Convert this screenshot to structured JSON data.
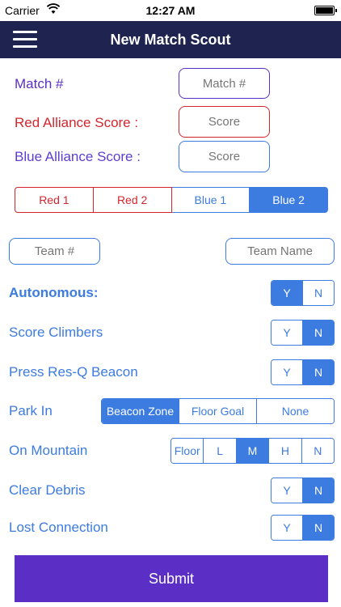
{
  "status_bar": {
    "carrier": "Carrier",
    "wifi_icon": "wifi-icon",
    "time": "12:27 AM",
    "battery_icon": "battery-icon"
  },
  "nav": {
    "menu_icon": "hamburger-menu-icon",
    "title": "New Match Scout"
  },
  "match": {
    "label": "Match #",
    "placeholder": "Match #"
  },
  "red_score": {
    "label": "Red Alliance Score :",
    "placeholder": "Score"
  },
  "blue_score": {
    "label": "Blue Alliance Score :",
    "placeholder": "Score"
  },
  "alliance_options": [
    "Red 1",
    "Red 2",
    "Blue 1",
    "Blue 2"
  ],
  "alliance_selected": "Blue 2",
  "team": {
    "number_placeholder": "Team #",
    "name_placeholder": "Team Name"
  },
  "autonomous": {
    "label": "Autonomous:",
    "options": [
      "Y",
      "N"
    ],
    "selected": "Y"
  },
  "score_climbers": {
    "label": "Score Climbers",
    "options": [
      "Y",
      "N"
    ],
    "selected": "N"
  },
  "press_beacon": {
    "label": "Press Res-Q Beacon",
    "options": [
      "Y",
      "N"
    ],
    "selected": "N"
  },
  "park_in": {
    "label": "Park In",
    "options": [
      "Beacon Zone",
      "Floor Goal",
      "None"
    ],
    "selected": "Beacon Zone"
  },
  "on_mountain": {
    "label": "On Mountain",
    "options": [
      "Floor",
      "L",
      "M",
      "H",
      "N"
    ],
    "selected": "M"
  },
  "clear_debris": {
    "label": "Clear Debris",
    "options": [
      "Y",
      "N"
    ],
    "selected": "N"
  },
  "lost_connection": {
    "label": "Lost Connection",
    "options": [
      "Y",
      "N"
    ],
    "selected": "N"
  },
  "submit_label": "Submit",
  "colors": {
    "nav_bg": "#1e2350",
    "purple": "#5b2fc6",
    "red": "#d3262c",
    "blue": "#3c7be0"
  }
}
